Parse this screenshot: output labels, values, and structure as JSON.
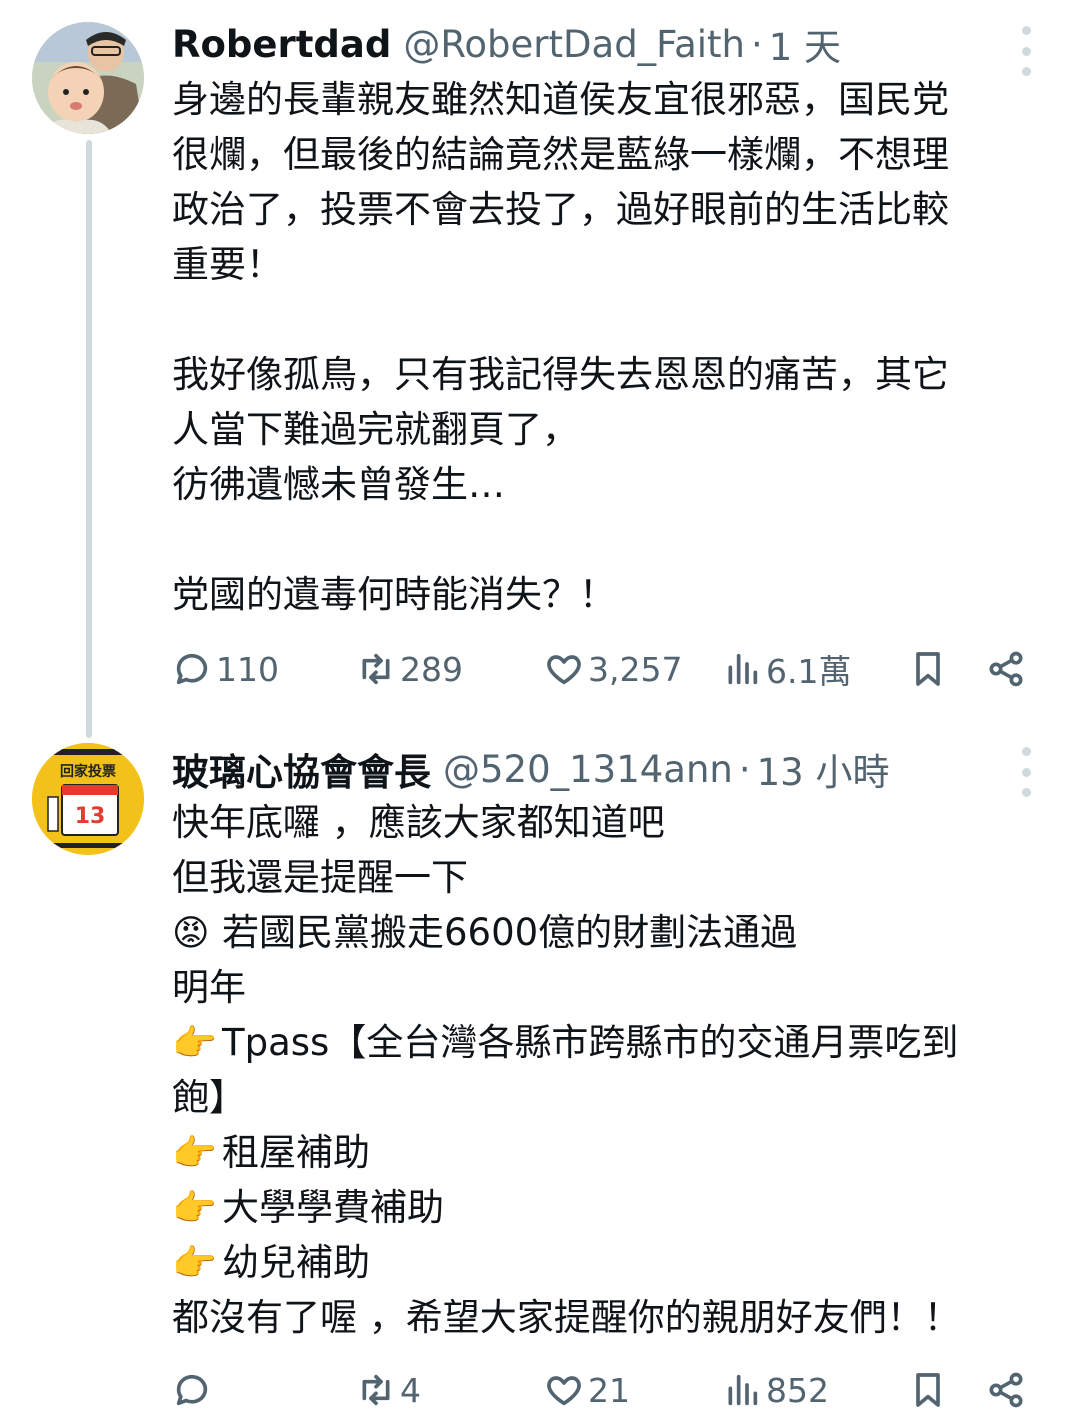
{
  "tweets": [
    {
      "display_name": "Robertdad",
      "handle": "@RobertDad_Faith",
      "separator": "·",
      "time": "1 天",
      "avatar_icon": "profile-photo-father-baby",
      "lines": [
        "身邊的長輩親友雖然知道侯友宜很邪惡，国民党",
        "很爛，但最後的結論竟然是藍綠一樣爛，不想理",
        "政治了，投票不會去投了，過好眼前的生活比較",
        "重要！",
        "",
        "我好像孤鳥，只有我記得失去恩恩的痛苦，其它",
        "人當下難過完就翻頁了，",
        "彷彿遺憾未曾發生…",
        "",
        "党國的遺毒何時能消失？！"
      ],
      "stats": {
        "replies": "110",
        "retweets": "289",
        "likes": "3,257",
        "views": "6.1萬"
      }
    },
    {
      "display_name": "玻璃心協會會長",
      "handle": "@520_1314ann",
      "separator": "·",
      "time": "13 小時",
      "avatar_icon": "calendar-vote-sticker",
      "avatar_text": {
        "top": "回家投票",
        "number": "13"
      },
      "lines": [
        {
          "emoji": "",
          "text": "快年底囉 ，應該大家都知道吧"
        },
        {
          "emoji": "",
          "text": "但我還是提醒一下"
        },
        {
          "emoji": "😡",
          "text": "若國民黨搬走6600億的財劃法通過"
        },
        {
          "emoji": "",
          "text": "明年"
        },
        {
          "emoji": "👉",
          "text": "Tpass【全台灣各縣市跨縣市的交通月票吃到"
        },
        {
          "emoji": "",
          "text": "飽】"
        },
        {
          "emoji": "👉",
          "text": "租屋補助"
        },
        {
          "emoji": "👉",
          "text": "大學學費補助"
        },
        {
          "emoji": "👉",
          "text": "幼兒補助"
        },
        {
          "emoji": "",
          "text": "都沒有了喔 ，希望大家提醒你的親朋好友們！！"
        }
      ],
      "stats": {
        "replies": "",
        "retweets": "4",
        "likes": "21",
        "views": "852"
      }
    }
  ],
  "icons": {
    "reply": "reply-icon",
    "retweet": "retweet-icon",
    "like": "heart-icon",
    "views": "views-chart-icon",
    "bookmark": "bookmark-icon",
    "share": "share-icon",
    "more": "more-vertical-icon"
  },
  "colors": {
    "text_primary": "#0f1419",
    "text_secondary": "#536471",
    "thread_line": "#cfd9de",
    "avatar2_bg": "#f2c21b"
  }
}
